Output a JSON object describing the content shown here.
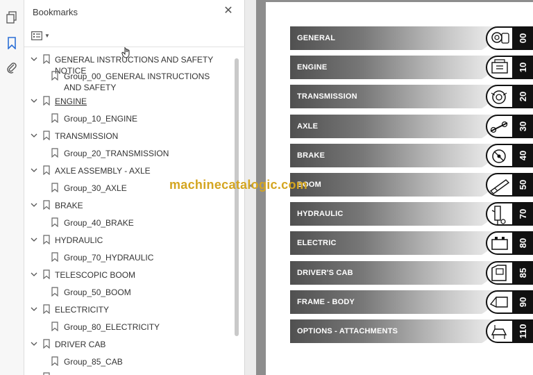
{
  "bookmarks_panel": {
    "title": "Bookmarks",
    "items": [
      {
        "label": "GENERAL INSTRUCTIONS AND SAFETY NOTICE",
        "level": 1
      },
      {
        "label": "Group_00_GENERAL INSTRUCTIONS AND SAFETY",
        "level": 2
      },
      {
        "label": "ENGINE",
        "level": 1
      },
      {
        "label": "Group_10_ENGINE",
        "level": 2
      },
      {
        "label": "TRANSMISSION",
        "level": 1
      },
      {
        "label": "Group_20_TRANSMISSION",
        "level": 2
      },
      {
        "label": "AXLE ASSEMBLY - AXLE",
        "level": 1
      },
      {
        "label": "Group_30_AXLE",
        "level": 2
      },
      {
        "label": "BRAKE",
        "level": 1
      },
      {
        "label": "Group_40_BRAKE",
        "level": 2
      },
      {
        "label": "HYDRAULIC",
        "level": 1
      },
      {
        "label": "Group_70_HYDRAULIC",
        "level": 2
      },
      {
        "label": "TELESCOPIC BOOM",
        "level": 1
      },
      {
        "label": "Group_50_BOOM",
        "level": 2
      },
      {
        "label": "ELECTRICITY",
        "level": 1
      },
      {
        "label": "Group_80_ELECTRICITY",
        "level": 2
      },
      {
        "label": "DRIVER CAB",
        "level": 1
      },
      {
        "label": "Group_85_CAB",
        "level": 2
      }
    ]
  },
  "sidebar_tools": [
    "pages-icon",
    "bookmark-icon",
    "attachment-icon"
  ],
  "document": {
    "sections": [
      {
        "label": "GENERAL",
        "number": "00",
        "icon": "tools-icon"
      },
      {
        "label": "ENGINE",
        "number": "10",
        "icon": "engine-icon"
      },
      {
        "label": "TRANSMISSION",
        "number": "20",
        "icon": "gearbox-icon"
      },
      {
        "label": "AXLE",
        "number": "30",
        "icon": "axle-icon"
      },
      {
        "label": "BRAKE",
        "number": "40",
        "icon": "brake-icon"
      },
      {
        "label": "BOOM",
        "number": "50",
        "icon": "boom-icon"
      },
      {
        "label": "HYDRAULIC",
        "number": "70",
        "icon": "hydraulic-icon"
      },
      {
        "label": "ELECTRIC",
        "number": "80",
        "icon": "battery-icon"
      },
      {
        "label": "DRIVER'S CAB",
        "number": "85",
        "icon": "cab-icon"
      },
      {
        "label": "FRAME - BODY",
        "number": "90",
        "icon": "frame-icon"
      },
      {
        "label": "OPTIONS - ATTACHMENTS",
        "number": "110",
        "icon": "attachment-tool-icon"
      }
    ]
  },
  "watermark": "machinecatalogic.com",
  "colors": {
    "accent": "#2b6fd6",
    "tab_dark": "#505050",
    "number_bg": "#111111",
    "watermark": "#d4a520"
  }
}
